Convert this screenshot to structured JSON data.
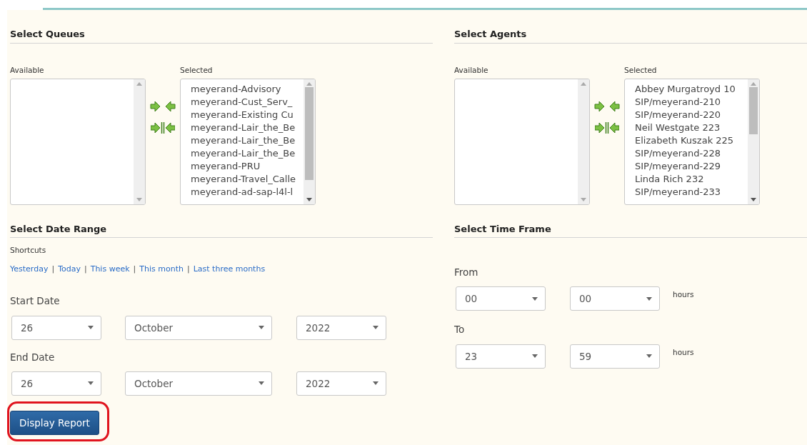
{
  "queues": {
    "title": "Select Queues",
    "available_label": "Available",
    "selected_label": "Selected",
    "selected_items": [
      "meyerand-Advisory",
      "meyerand-Cust_Serv_",
      "meyerand-Existing Cu",
      "meyerand-Lair_the_Be",
      "meyerand-Lair_the_Be",
      "meyerand-Lair_the_Be",
      "meyerand-PRU",
      "meyerand-Travel_Calle",
      "meyerand-ad-sap-l4l-l"
    ]
  },
  "agents": {
    "title": "Select Agents",
    "available_label": "Available",
    "selected_label": "Selected",
    "selected_items": [
      "Abbey Murgatroyd 10",
      "SIP/meyerand-210",
      "SIP/meyerand-220",
      "Neil Westgate 223",
      "Elizabeth Kuszak 225",
      "SIP/meyerand-228",
      "SIP/meyerand-229",
      "Linda Rich 232",
      "SIP/meyerand-233"
    ]
  },
  "date_range": {
    "title": "Select Date Range",
    "shortcuts_label": "Shortcuts",
    "separator": "|",
    "shortcuts": [
      "Yesterday",
      "Today",
      "This week",
      "This month",
      "Last three months"
    ],
    "start_label": "Start Date",
    "start": {
      "day": "26",
      "month": "October",
      "year": "2022"
    },
    "end_label": "End Date",
    "end": {
      "day": "26",
      "month": "October",
      "year": "2022"
    }
  },
  "time_frame": {
    "title": "Select Time Frame",
    "from_label": "From",
    "from": {
      "hour": "00",
      "minute": "00",
      "unit": "hours"
    },
    "to_label": "To",
    "to": {
      "hour": "23",
      "minute": "59",
      "unit": "hours"
    }
  },
  "display_button": {
    "label": "Display Report"
  }
}
